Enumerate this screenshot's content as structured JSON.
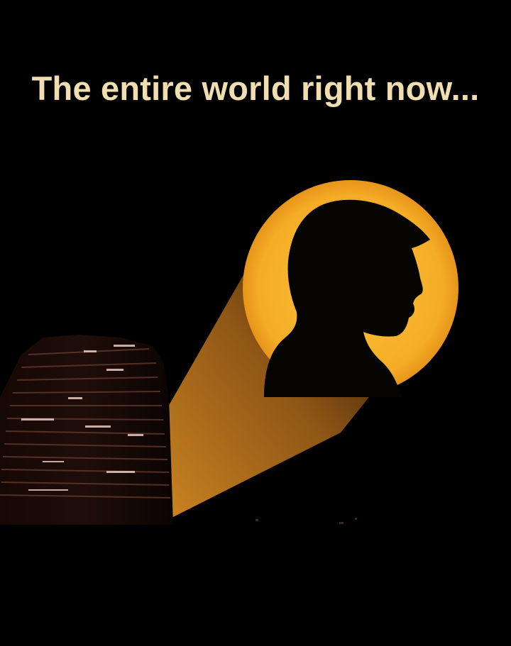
{
  "caption": {
    "text": "The entire world right now..."
  },
  "colors": {
    "background": "#000000",
    "caption_text": "#f1deb0",
    "signal_yellow": "#f7b52b",
    "beam_orange": "#c47d1c",
    "silhouette": "#050403"
  },
  "icons": {
    "signal": "spotlight-signal-with-head-silhouette",
    "building": "dark-office-tower"
  }
}
